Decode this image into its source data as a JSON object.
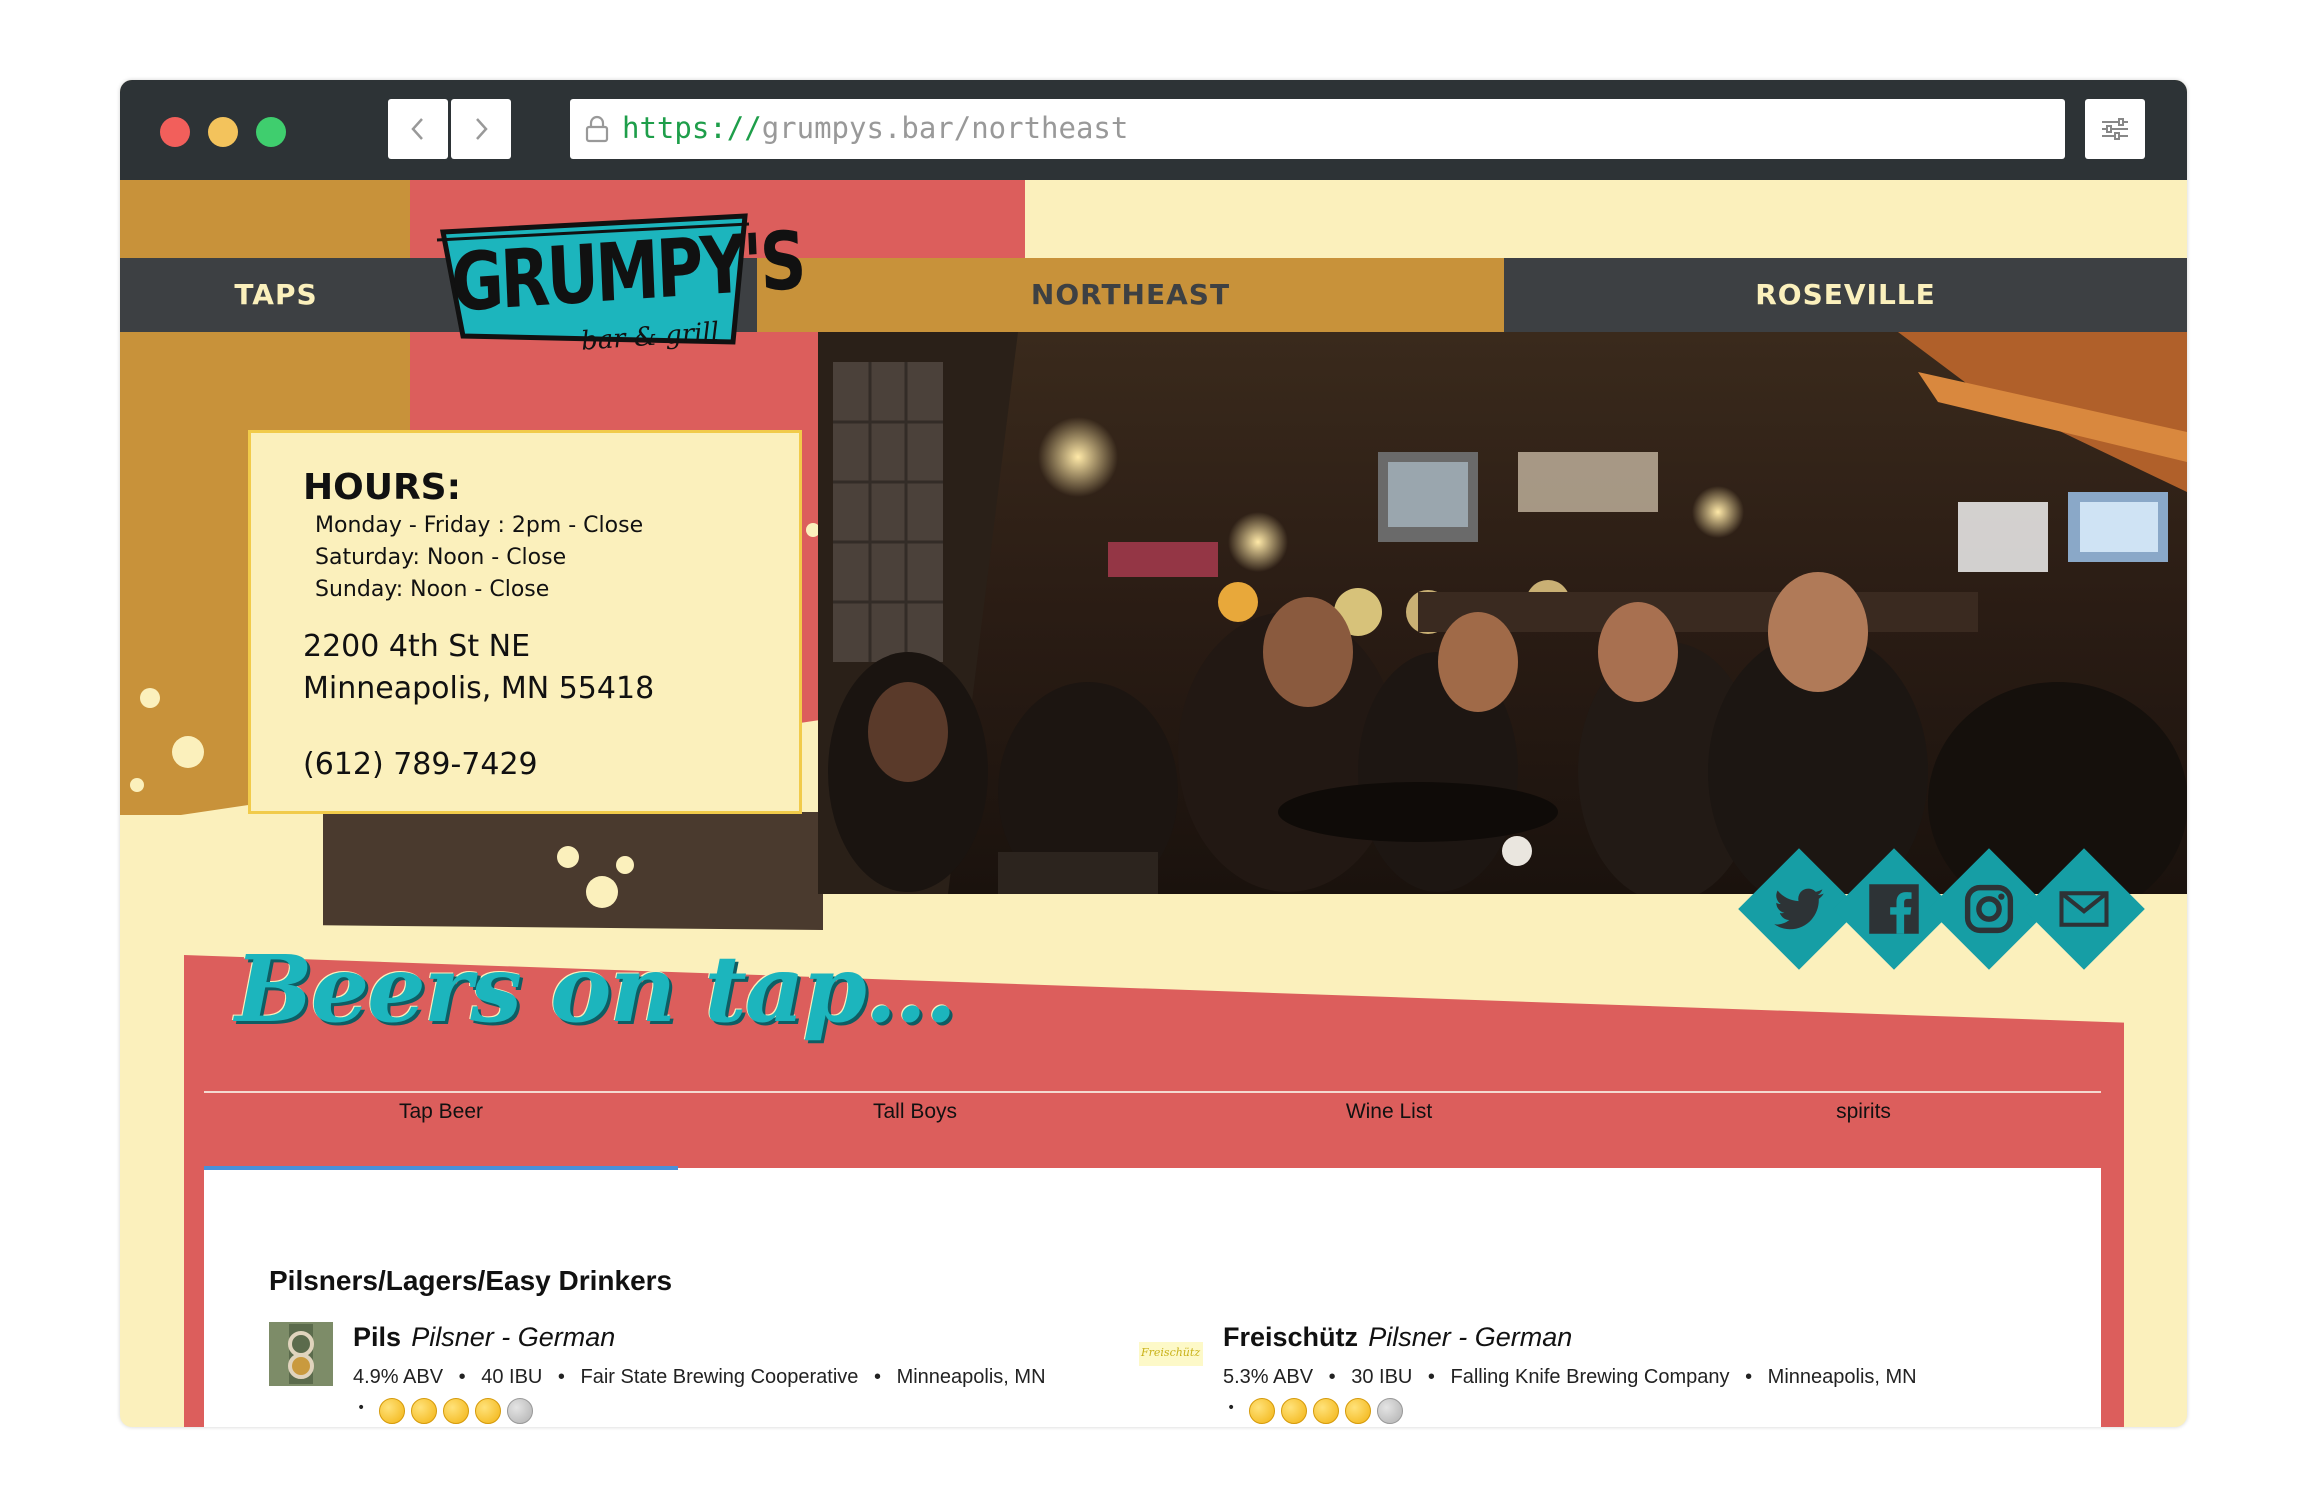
{
  "browser": {
    "url_protocol": "https://",
    "url_rest": "grumpys.bar/northeast",
    "back_icon": "chevron-left-icon",
    "forward_icon": "chevron-right-icon"
  },
  "nav": {
    "taps": "TAPS",
    "northeast": "NORTHEAST",
    "roseville": "ROSEVILLE"
  },
  "logo": {
    "name": "GRUMPY'S",
    "tagline": "bar & grill"
  },
  "hours": {
    "heading": "HOURS:",
    "weekday": "Monday - Friday : 2pm - Close",
    "saturday": "Saturday: Noon - Close",
    "sunday": "Sunday: Noon - Close",
    "street": "2200 4th St NE",
    "city": "Minneapolis, MN 55418",
    "phone": "(612) 789-7429"
  },
  "social": [
    "twitter-icon",
    "facebook-icon",
    "instagram-icon",
    "email-icon"
  ],
  "beers": {
    "title": "Beers on tap...",
    "tabs": [
      "Tap Beer",
      "Tall Boys",
      "Wine List",
      "spirits"
    ],
    "active_tab": "Tap Beer",
    "category": "Pilsners/Lagers/Easy Drinkers",
    "items": [
      {
        "name": "Pils",
        "style": "Pilsner - German",
        "abv": "4.9% ABV",
        "ibu": "40 IBU",
        "brewery": "Fair State Brewing Cooperative",
        "location": "Minneapolis, MN",
        "rating": 4
      },
      {
        "name": "Freischütz",
        "style": "Pilsner - German",
        "abv": "5.3% ABV",
        "ibu": "30 IBU",
        "brewery": "Falling Knife Brewing Company",
        "location": "Minneapolis, MN",
        "rating": 4,
        "logo_text": "Freischütz"
      }
    ],
    "separator": "•"
  },
  "colors": {
    "cream": "#fbf0bc",
    "mustard": "#c8923a",
    "coral": "#dc5e5c",
    "charcoal": "#3d4043",
    "teal": "#169ea5",
    "brown": "#4a3a2e"
  }
}
